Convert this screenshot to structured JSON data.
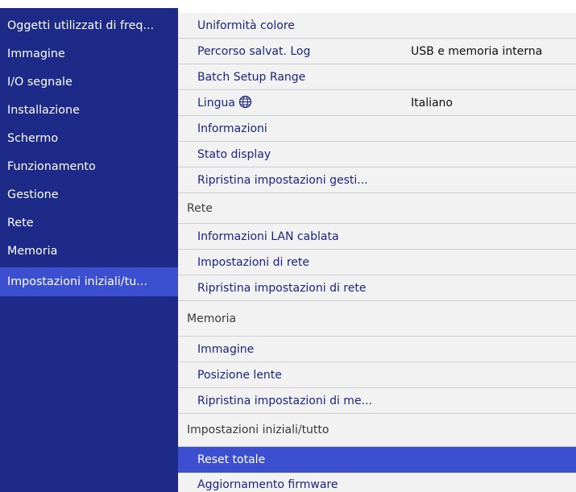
{
  "sidebar": {
    "items": [
      {
        "label": "Oggetti utilizzati di freq..."
      },
      {
        "label": "Immagine"
      },
      {
        "label": "I/O segnale"
      },
      {
        "label": "Installazione"
      },
      {
        "label": "Schermo"
      },
      {
        "label": "Funzionamento"
      },
      {
        "label": "Gestione"
      },
      {
        "label": "Rete"
      },
      {
        "label": "Memoria"
      },
      {
        "label": "Impostazioni iniziali/tu...",
        "selected": true
      }
    ]
  },
  "main": {
    "rows": [
      {
        "type": "item",
        "label": "Uniformità colore"
      },
      {
        "type": "item",
        "label": "Percorso salvat. Log",
        "value": "USB e memoria interna"
      },
      {
        "type": "item",
        "label": "Batch Setup Range"
      },
      {
        "type": "item",
        "label": "Lingua",
        "icon": "globe-icon",
        "value": "Italiano"
      },
      {
        "type": "item",
        "label": "Informazioni"
      },
      {
        "type": "item",
        "label": "Stato display"
      },
      {
        "type": "item",
        "label": "Ripristina impostazioni gesti..."
      },
      {
        "type": "header",
        "label": "Rete"
      },
      {
        "type": "item",
        "label": "Informazioni LAN cablata"
      },
      {
        "type": "item",
        "label": "Impostazioni di rete"
      },
      {
        "type": "item",
        "label": "Ripristina impostazioni di rete"
      },
      {
        "type": "header",
        "label": "Memoria"
      },
      {
        "type": "item",
        "label": "Immagine"
      },
      {
        "type": "item",
        "label": "Posizione lente"
      },
      {
        "type": "item",
        "label": "Ripristina impostazioni di me..."
      },
      {
        "type": "header",
        "label": "Impostazioni iniziali/tutto"
      },
      {
        "type": "item",
        "label": "Reset totale",
        "selected": true
      },
      {
        "type": "item",
        "label": "Aggiornamento firmware"
      }
    ]
  },
  "colors": {
    "sidebar_bg": "#1d2a88",
    "selection": "#3b4fd0",
    "row_bg": "#f2f2f2",
    "item_text": "#1c2483"
  }
}
